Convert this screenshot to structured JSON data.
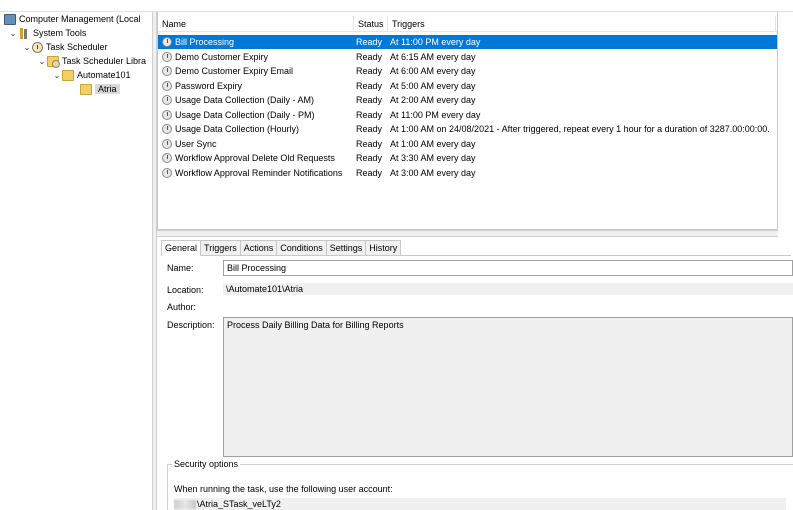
{
  "tree": {
    "items": [
      {
        "label": "Computer Management (Local",
        "icon": "computer-icon",
        "chevron": "",
        "depth": 0
      },
      {
        "label": "System Tools",
        "icon": "tools-icon",
        "chevron": "v",
        "depth": 1
      },
      {
        "label": "Task Scheduler",
        "icon": "clock-icon",
        "chevron": "v",
        "depth": 2
      },
      {
        "label": "Task Scheduler Libra",
        "icon": "library-folder-icon",
        "chevron": "v",
        "depth": 3
      },
      {
        "label": "Automate101",
        "icon": "folder-icon",
        "chevron": "v",
        "depth": 4
      },
      {
        "label": "Atria",
        "icon": "folder-icon",
        "chevron": "",
        "depth": 5
      }
    ]
  },
  "tasklist": {
    "columns": {
      "name": "Name",
      "status": "Status",
      "triggers": "Triggers"
    },
    "rows": [
      {
        "name": "Bill Processing",
        "status": "Ready",
        "trigger": "At 11:00 PM every day"
      },
      {
        "name": "Demo Customer Expiry",
        "status": "Ready",
        "trigger": "At 6:15 AM every day"
      },
      {
        "name": "Demo Customer Expiry Email",
        "status": "Ready",
        "trigger": "At 6:00 AM every day"
      },
      {
        "name": "Password Expiry",
        "status": "Ready",
        "trigger": "At 5:00 AM every day"
      },
      {
        "name": "Usage Data Collection (Daily - AM)",
        "status": "Ready",
        "trigger": "At 2:00 AM every day"
      },
      {
        "name": "Usage Data Collection (Daily - PM)",
        "status": "Ready",
        "trigger": "At 11:00 PM every day"
      },
      {
        "name": "Usage Data Collection (Hourly)",
        "status": "Ready",
        "trigger": "At 1:00 AM on 24/08/2021 - After triggered, repeat every 1 hour for a duration of 3287.00:00:00."
      },
      {
        "name": "User Sync",
        "status": "Ready",
        "trigger": "At 1:00 AM every day"
      },
      {
        "name": "Workflow Approval Delete Old Requests",
        "status": "Ready",
        "trigger": "At 3:30 AM every day"
      },
      {
        "name": "Workflow Approval Reminder Notifications",
        "status": "Ready",
        "trigger": "At 3:00 AM every day"
      }
    ]
  },
  "details": {
    "tabs": [
      "General",
      "Triggers",
      "Actions",
      "Conditions",
      "Settings",
      "History"
    ],
    "name_label": "Name:",
    "name_value": "Bill Processing",
    "location_label": "Location:",
    "location_value": "\\Automate101\\Atria",
    "author_label": "Author:",
    "author_value": "",
    "description_label": "Description:",
    "description_value": "Process Daily Billing Data for Billing Reports",
    "security_title": "Security options",
    "security_text": "When running the task, use the following user account:",
    "account_value": "\\Atria_STask_veLTy2"
  },
  "colors": {
    "selection": "#0078d7",
    "folder": "#f3cf64"
  }
}
